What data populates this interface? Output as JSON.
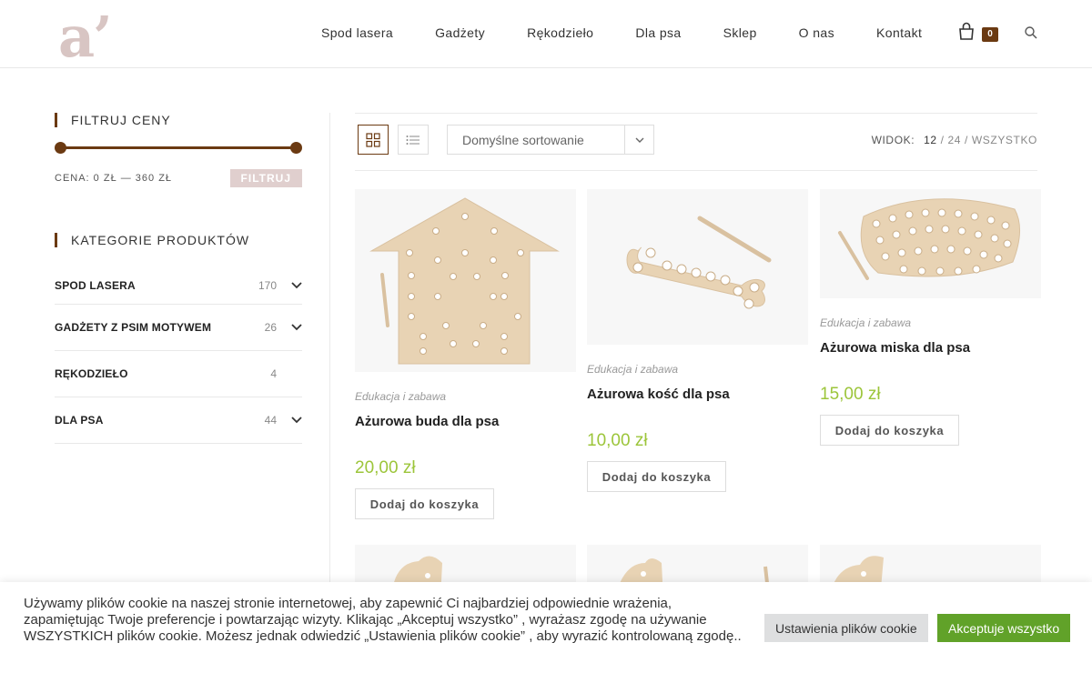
{
  "brand": {
    "logo_text": "a’"
  },
  "nav": {
    "items": [
      "Spod lasera",
      "Gadżety",
      "Rękodzieło",
      "Dla psa",
      "Sklep",
      "O nas",
      "Kontakt"
    ],
    "cart_count": "0"
  },
  "sidebar": {
    "price_filter": {
      "title": "FILTRUJ CENY",
      "price_label": "CENA: 0 ZŁ — 360 ZŁ",
      "filter_button": "FILTRUJ",
      "min_fraction": 0,
      "max_fraction": 1
    },
    "categories": {
      "title": "KATEGORIE PRODUKTÓW",
      "items": [
        {
          "name": "SPOD LASERA",
          "count": "170",
          "expandable": true
        },
        {
          "name": "GADŻETY Z PSIM MOTYWEM",
          "count": "26",
          "expandable": true
        },
        {
          "name": "RĘKODZIEŁO",
          "count": "4",
          "expandable": false
        },
        {
          "name": "DLA PSA",
          "count": "44",
          "expandable": true
        }
      ]
    }
  },
  "toolbar": {
    "sort_selected": "Domyślne sortowanie",
    "view_label": "WIDOK:",
    "view_options": [
      "12",
      "24",
      "WSZYSTKO"
    ],
    "view_current": "12",
    "separator": "/"
  },
  "products": [
    {
      "category": "Edukacja i zabawa",
      "name": "Ażurowa buda dla psa",
      "price": "20,00 zł",
      "button": "Dodaj do koszyka",
      "image": "wooden-house-lacing"
    },
    {
      "category": "Edukacja i zabawa",
      "name": "Ażurowa kość dla psa",
      "price": "10,00 zł",
      "button": "Dodaj do koszyka",
      "image": "wooden-bone-lacing"
    },
    {
      "category": "Edukacja i zabawa",
      "name": "Ażurowa miska dla psa",
      "price": "15,00 zł",
      "button": "Dodaj do koszyka",
      "image": "wooden-bowl-lacing"
    }
  ],
  "cookie": {
    "text": "Używamy plików cookie na naszej stronie internetowej, aby zapewnić Ci najbardziej odpowiednie wrażenia, zapamiętując Twoje preferencje i powtarzając wizyty. Klikając „Akceptuj wszystko” , wyrażasz zgodę na używanie WSZYSTKICH plików cookie. Możesz jednak odwiedzić „Ustawienia plików cookie” , aby wyrazić kontrolowaną zgodę..",
    "settings_button": "Ustawienia plików cookie",
    "accept_button": "Akceptuje wszystko"
  },
  "colors": {
    "accent": "#6b3a12",
    "price": "#9cc53a",
    "accept": "#61a229",
    "logo": "#d8c5c3"
  }
}
